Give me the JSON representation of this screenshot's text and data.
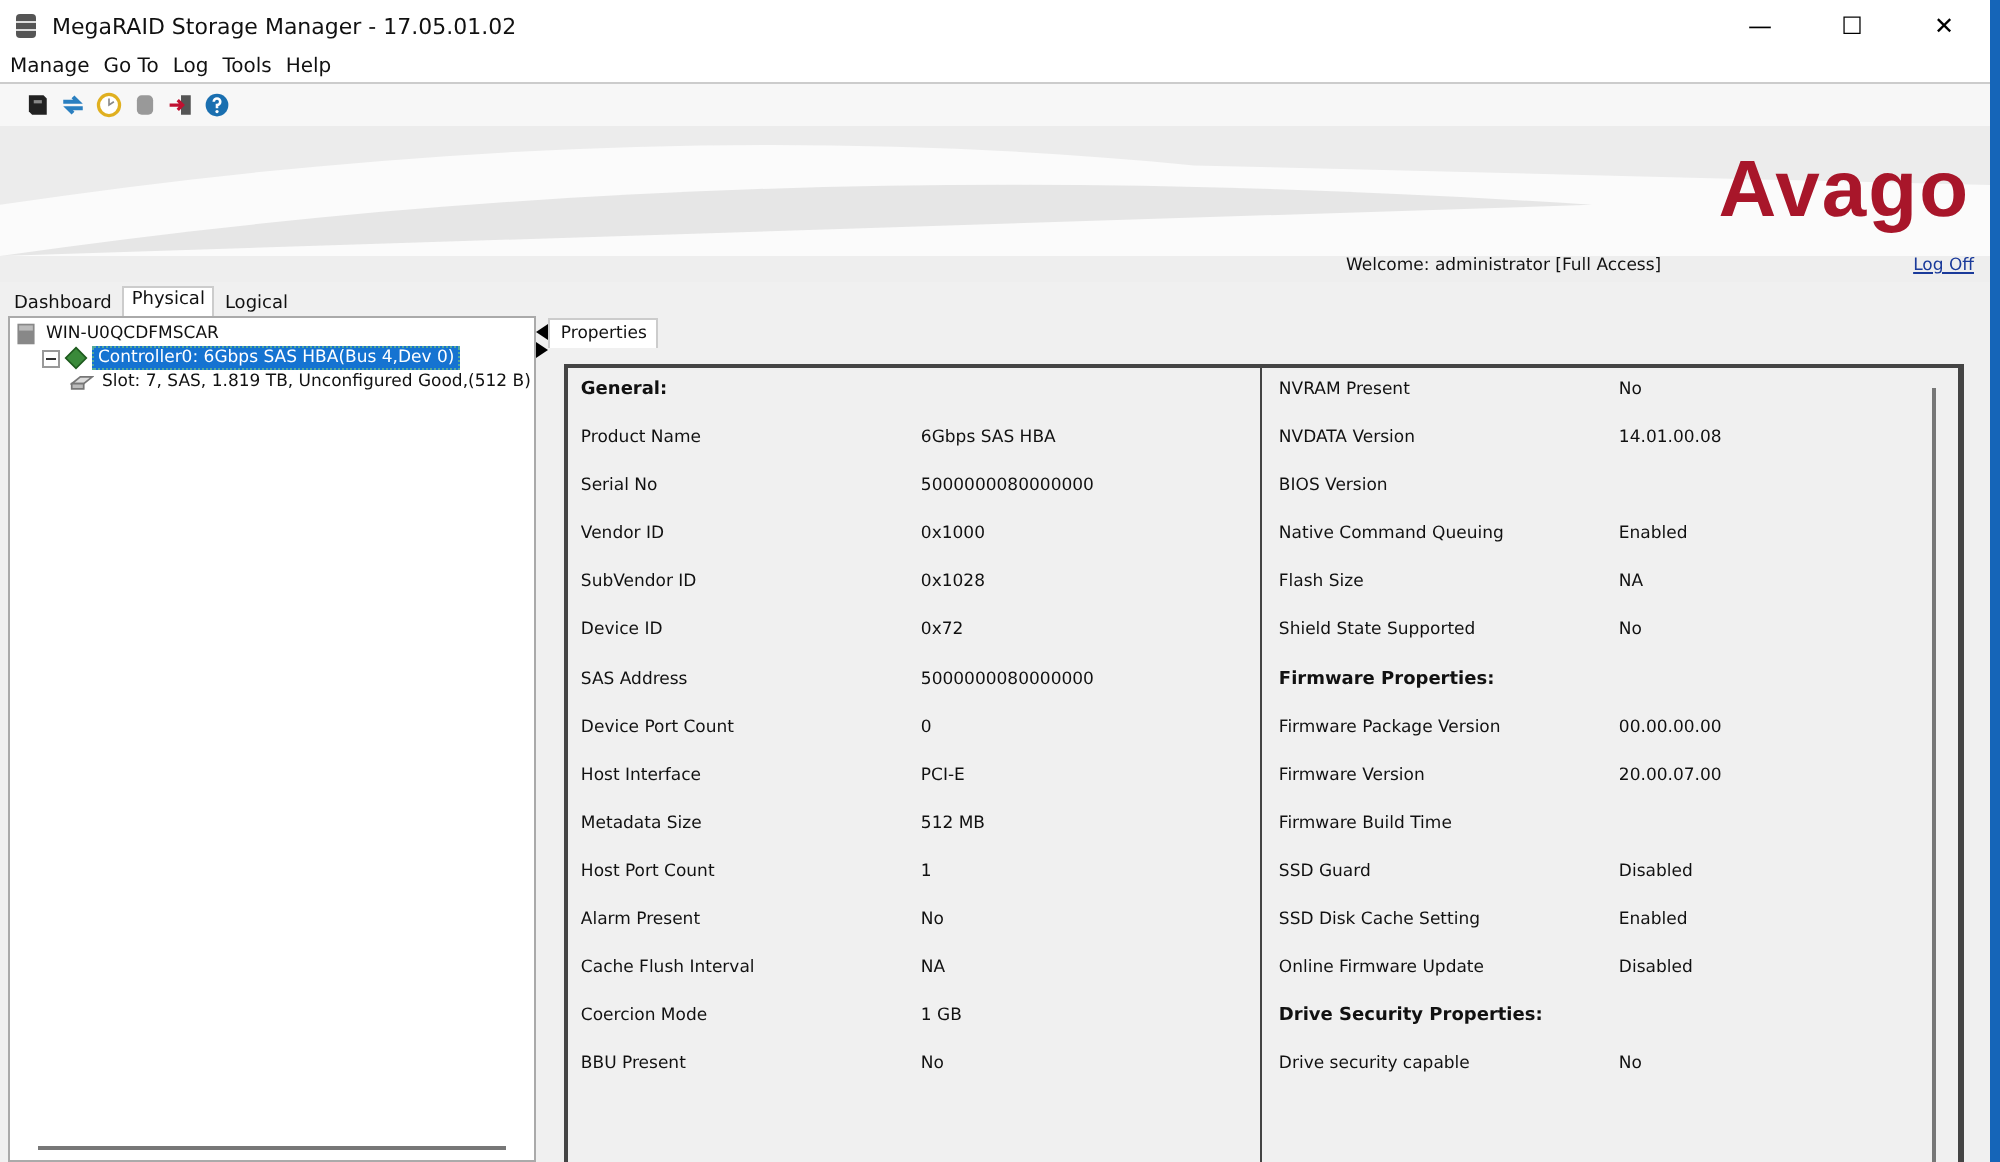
{
  "window": {
    "title": "MegaRAID Storage Manager - 17.05.01.02",
    "controls": [
      "—",
      "☐",
      "✕"
    ]
  },
  "menu": [
    "Manage",
    "Go To",
    "Log",
    "Tools",
    "Help"
  ],
  "toolbar": [
    {
      "kind": "server"
    },
    {
      "kind": "refresh"
    },
    {
      "kind": "clock"
    },
    {
      "kind": "disk"
    },
    {
      "kind": "exit"
    },
    {
      "kind": "help"
    }
  ],
  "banner": {
    "logo": "Avago",
    "welcome": "Welcome: administrator [Full Access]",
    "logoff": "Log Off"
  },
  "tabs": [
    {
      "label": "Dashboard",
      "selected": false
    },
    {
      "label": "Physical",
      "selected": true
    },
    {
      "label": "Logical",
      "selected": false
    }
  ],
  "tree": [
    {
      "label": "WIN-U0QCDFMSCAR",
      "kind": "host",
      "selected": false,
      "children": [
        {
          "label": "Controller0: 6Gbps SAS HBA(Bus 4,Dev 0)",
          "kind": "controller",
          "selected": true,
          "expanded": true,
          "children": [
            {
              "label": "Slot: 7, SAS, 1.819 TB, Unconfigured Good,(512 B)",
              "kind": "drive",
              "selected": false
            }
          ]
        }
      ]
    }
  ],
  "properties_tab": "Properties",
  "columns": [
    [
      {
        "kind": "header",
        "label": "General:"
      },
      {
        "kind": "pair",
        "label": "Product Name",
        "value": "6Gbps SAS HBA"
      },
      {
        "kind": "pair",
        "label": "Serial No",
        "value": "5000000080000000"
      },
      {
        "kind": "pair",
        "label": "Vendor ID",
        "value": "0x1000"
      },
      {
        "kind": "pair",
        "label": "SubVendor ID",
        "value": "0x1028"
      },
      {
        "kind": "pair",
        "label": "Device ID",
        "value": "0x72"
      },
      {
        "kind": "pair",
        "label": "SAS Address",
        "value": "5000000080000000"
      },
      {
        "kind": "pair",
        "label": "Device Port Count",
        "value": "0"
      },
      {
        "kind": "pair",
        "label": "Host Interface",
        "value": "PCI-E"
      },
      {
        "kind": "pair",
        "label": "Metadata Size",
        "value": "512 MB"
      },
      {
        "kind": "pair",
        "label": "Host Port Count",
        "value": "1"
      },
      {
        "kind": "pair",
        "label": "Alarm Present",
        "value": "No"
      },
      {
        "kind": "pair",
        "label": "Cache Flush Interval",
        "value": "NA"
      },
      {
        "kind": "pair",
        "label": "Coercion Mode",
        "value": "1 GB"
      },
      {
        "kind": "pair",
        "label": "BBU Present",
        "value": "No"
      }
    ],
    [
      {
        "kind": "pair",
        "label": "NVRAM Present",
        "value": "No"
      },
      {
        "kind": "pair",
        "label": "NVDATA Version",
        "value": "14.01.00.08"
      },
      {
        "kind": "pair",
        "label": "BIOS Version"
      },
      {
        "kind": "pair",
        "label": "Native Command Queuing",
        "value": "Enabled"
      },
      {
        "kind": "pair",
        "label": "Flash Size",
        "value": "NA"
      },
      {
        "kind": "pair",
        "label": "Shield State Supported",
        "value": "No"
      },
      {
        "kind": "header",
        "label": "Firmware Properties:"
      },
      {
        "kind": "pair",
        "label": "Firmware Package Version",
        "value": "00.00.00.00"
      },
      {
        "kind": "pair",
        "label": "Firmware Version",
        "value": "20.00.07.00"
      },
      {
        "kind": "pair",
        "label": "Firmware Build Time"
      },
      {
        "kind": "pair",
        "label": "SSD Guard",
        "value": "Disabled"
      },
      {
        "kind": "pair",
        "label": "SSD Disk Cache Setting",
        "value": "Enabled"
      },
      {
        "kind": "pair",
        "label": "Online Firmware Update",
        "value": "Disabled"
      },
      {
        "kind": "header",
        "label": "Drive Security Properties:"
      },
      {
        "kind": "pair",
        "label": "Drive security capable",
        "value": "No"
      }
    ]
  ]
}
